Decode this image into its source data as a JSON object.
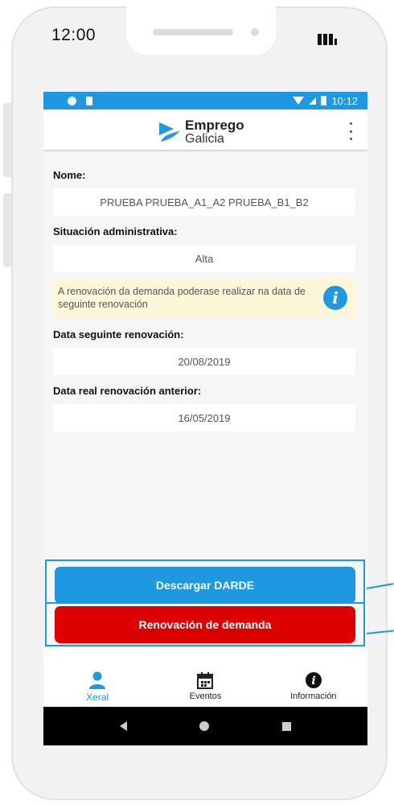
{
  "device": {
    "time": "12:00"
  },
  "android_status": {
    "time": "10:12"
  },
  "app": {
    "logo_line1": "Emprego",
    "logo_line2": "Galicia"
  },
  "fields": [
    {
      "label": "Nome:",
      "value": "PRUEBA PRUEBA_A1_A2 PRUEBA_B1_B2"
    },
    {
      "label": "Situación administrativa:",
      "value": "Alta"
    },
    {
      "label": "Data seguinte renovación:",
      "value": "20/08/2019"
    },
    {
      "label": "Data real renovación anterior:",
      "value": "16/05/2019"
    }
  ],
  "notice": {
    "text": "A renovación da demanda poderase realizar na data de seguinte renovación"
  },
  "actions": {
    "download_label": "Descargar DARDE",
    "renew_label": "Renovación de demanda"
  },
  "nav": [
    {
      "label": "Xeral",
      "icon": "person-icon",
      "active": true
    },
    {
      "label": "Eventos",
      "icon": "calendar-icon",
      "active": false
    },
    {
      "label": "Información",
      "icon": "info-icon",
      "active": false
    }
  ],
  "colors": {
    "primary": "#1e98e0",
    "danger": "#dc0000",
    "notice_bg": "#fcf7d8"
  }
}
